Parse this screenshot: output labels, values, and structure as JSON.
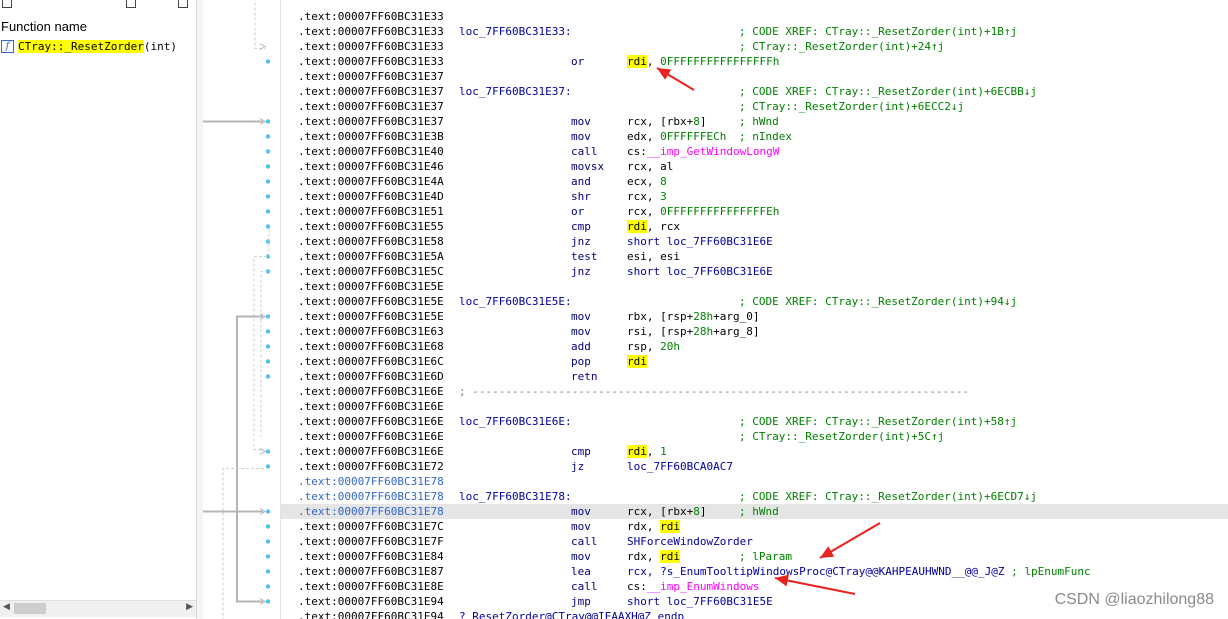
{
  "function_pane": {
    "header": "Function name",
    "function_icon_glyph": "f",
    "function_name_highlight": "CTray::_ResetZorder",
    "function_name_rest": "(int)"
  },
  "listing": [
    {
      "addr": ".text:00007FF60BC31E33"
    },
    {
      "addr": ".text:00007FF60BC31E33",
      "label": "loc_7FF60BC31E33:",
      "comment": "; CODE XREF: CTray::_ResetZorder(int)+1B↑j"
    },
    {
      "addr": ".text:00007FF60BC31E33",
      "comment": "; CTray::_ResetZorder(int)+24↑j"
    },
    {
      "addr": ".text:00007FF60BC31E33",
      "mn": "or",
      "op": [
        {
          "t": "rdi",
          "c": "hl"
        },
        {
          "t": ", "
        },
        {
          "t": "0FFFFFFFFFFFFFFFFh",
          "c": "num"
        }
      ]
    },
    {
      "addr": ".text:00007FF60BC31E37"
    },
    {
      "addr": ".text:00007FF60BC31E37",
      "label": "loc_7FF60BC31E37:",
      "comment": "; CODE XREF: CTray::_ResetZorder(int)+6ECBB↓j"
    },
    {
      "addr": ".text:00007FF60BC31E37",
      "comment": "; CTray::_ResetZorder(int)+6ECC2↓j"
    },
    {
      "addr": ".text:00007FF60BC31E37",
      "mn": "mov",
      "op": [
        {
          "t": "rcx, [rbx+"
        },
        {
          "t": "8",
          "c": "num"
        },
        {
          "t": "]"
        }
      ],
      "comment": "; hWnd"
    },
    {
      "addr": ".text:00007FF60BC31E3B",
      "mn": "mov",
      "op": [
        {
          "t": "edx, "
        },
        {
          "t": "0FFFFFFECh",
          "c": "num"
        }
      ],
      "comment": "; nIndex"
    },
    {
      "addr": ".text:00007FF60BC31E40",
      "mn": "call",
      "op": [
        {
          "t": "cs:"
        },
        {
          "t": "__imp_GetWindowLongW",
          "c": "imp"
        }
      ]
    },
    {
      "addr": ".text:00007FF60BC31E46",
      "mn": "movsx",
      "op": [
        {
          "t": "rcx, al"
        }
      ]
    },
    {
      "addr": ".text:00007FF60BC31E4A",
      "mn": "and",
      "op": [
        {
          "t": "ecx, "
        },
        {
          "t": "8",
          "c": "num"
        }
      ]
    },
    {
      "addr": ".text:00007FF60BC31E4D",
      "mn": "shr",
      "op": [
        {
          "t": "rcx, "
        },
        {
          "t": "3",
          "c": "num"
        }
      ]
    },
    {
      "addr": ".text:00007FF60BC31E51",
      "mn": "or",
      "op": [
        {
          "t": "rcx, "
        },
        {
          "t": "0FFFFFFFFFFFFFFFEh",
          "c": "num"
        }
      ]
    },
    {
      "addr": ".text:00007FF60BC31E55",
      "mn": "cmp",
      "op": [
        {
          "t": "rdi",
          "c": "hl"
        },
        {
          "t": ", rcx"
        }
      ]
    },
    {
      "addr": ".text:00007FF60BC31E58",
      "mn": "jnz",
      "op": [
        {
          "t": "short loc_7FF60BC31E6E",
          "c": "navy"
        }
      ]
    },
    {
      "addr": ".text:00007FF60BC31E5A",
      "mn": "test",
      "op": [
        {
          "t": "esi, esi"
        }
      ]
    },
    {
      "addr": ".text:00007FF60BC31E5C",
      "mn": "jnz",
      "op": [
        {
          "t": "short loc_7FF60BC31E6E",
          "c": "navy"
        }
      ]
    },
    {
      "addr": ".text:00007FF60BC31E5E"
    },
    {
      "addr": ".text:00007FF60BC31E5E",
      "label": "loc_7FF60BC31E5E:",
      "comment": "; CODE XREF: CTray::_ResetZorder(int)+94↓j"
    },
    {
      "addr": ".text:00007FF60BC31E5E",
      "mn": "mov",
      "op": [
        {
          "t": "rbx, [rsp+"
        },
        {
          "t": "28h",
          "c": "num"
        },
        {
          "t": "+arg_0]"
        }
      ]
    },
    {
      "addr": ".text:00007FF60BC31E63",
      "mn": "mov",
      "op": [
        {
          "t": "rsi, [rsp+"
        },
        {
          "t": "28h",
          "c": "num"
        },
        {
          "t": "+arg_8]"
        }
      ]
    },
    {
      "addr": ".text:00007FF60BC31E68",
      "mn": "add",
      "op": [
        {
          "t": "rsp, "
        },
        {
          "t": "20h",
          "c": "num"
        }
      ]
    },
    {
      "addr": ".text:00007FF60BC31E6C",
      "mn": "pop",
      "op": [
        {
          "t": "rdi",
          "c": "hl"
        }
      ]
    },
    {
      "addr": ".text:00007FF60BC31E6D",
      "mn": "retn"
    },
    {
      "addr": ".text:00007FF60BC31E6E",
      "sep": "; ---------------------------------------------------------------------------"
    },
    {
      "addr": ".text:00007FF60BC31E6E"
    },
    {
      "addr": ".text:00007FF60BC31E6E",
      "label": "loc_7FF60BC31E6E:",
      "comment": "; CODE XREF: CTray::_ResetZorder(int)+58↑j"
    },
    {
      "addr": ".text:00007FF60BC31E6E",
      "comment": "; CTray::_ResetZorder(int)+5C↑j"
    },
    {
      "addr": ".text:00007FF60BC31E6E",
      "mn": "cmp",
      "op": [
        {
          "t": "rdi",
          "c": "hl"
        },
        {
          "t": ", "
        },
        {
          "t": "1",
          "c": "num"
        }
      ]
    },
    {
      "addr": ".text:00007FF60BC31E72",
      "mn": "jz",
      "op": [
        {
          "t": "loc_7FF60BCA0AC7",
          "c": "navy"
        }
      ]
    },
    {
      "addr": ".text:00007FF60BC31E78",
      "blue": true
    },
    {
      "addr": ".text:00007FF60BC31E78",
      "blue": true,
      "label": "loc_7FF60BC31E78:",
      "comment": "; CODE XREF: CTray::_ResetZorder(int)+6ECD7↓j"
    },
    {
      "addr": ".text:00007FF60BC31E78",
      "blue": true,
      "sel": true,
      "mn": "mov",
      "op": [
        {
          "t": "rcx, [rbx+"
        },
        {
          "t": "8",
          "c": "num"
        },
        {
          "t": "]"
        }
      ],
      "comment": "; hWnd"
    },
    {
      "addr": ".text:00007FF60BC31E7C",
      "mn": "mov",
      "op": [
        {
          "t": "rdx, "
        },
        {
          "t": "rdi",
          "c": "hl"
        }
      ]
    },
    {
      "addr": ".text:00007FF60BC31E7F",
      "mn": "call",
      "op": [
        {
          "t": "SHForceWindowZorder",
          "c": "navy"
        }
      ]
    },
    {
      "addr": ".text:00007FF60BC31E84",
      "mn": "mov",
      "op": [
        {
          "t": "rdx, "
        },
        {
          "t": "rdi",
          "c": "hl"
        }
      ],
      "comment": "; lParam"
    },
    {
      "addr": ".text:00007FF60BC31E87",
      "mn": "lea",
      "op": [
        {
          "t": "rcx, ?s_EnumTooltipWindowsProc@CTray@@KAHPEAUHWND__@@_J@Z",
          "c": "navy"
        },
        {
          "t": " ; lpEnumFunc",
          "c": "num"
        }
      ]
    },
    {
      "addr": ".text:00007FF60BC31E8E",
      "mn": "call",
      "op": [
        {
          "t": "cs:"
        },
        {
          "t": "__imp_EnumWindows",
          "c": "imp"
        }
      ]
    },
    {
      "addr": ".text:00007FF60BC31E94",
      "mn": "jmp",
      "op": [
        {
          "t": "short loc_7FF60BC31E5E",
          "c": "navy"
        }
      ]
    },
    {
      "addr": ".text:00007FF60BC31E94",
      "label": "?_ResetZorder@CTray@@IEAAXH@Z endp"
    }
  ],
  "watermark": "CSDN @liaozhilong88",
  "colors": {
    "highlight": "#ffff00",
    "annotation_arrow": "#e8231f",
    "comment": "#008000",
    "import": "#ff00ff",
    "name": "#00009a",
    "address_blue": "#3166c9",
    "flow_dots": "#4fc3f7"
  }
}
